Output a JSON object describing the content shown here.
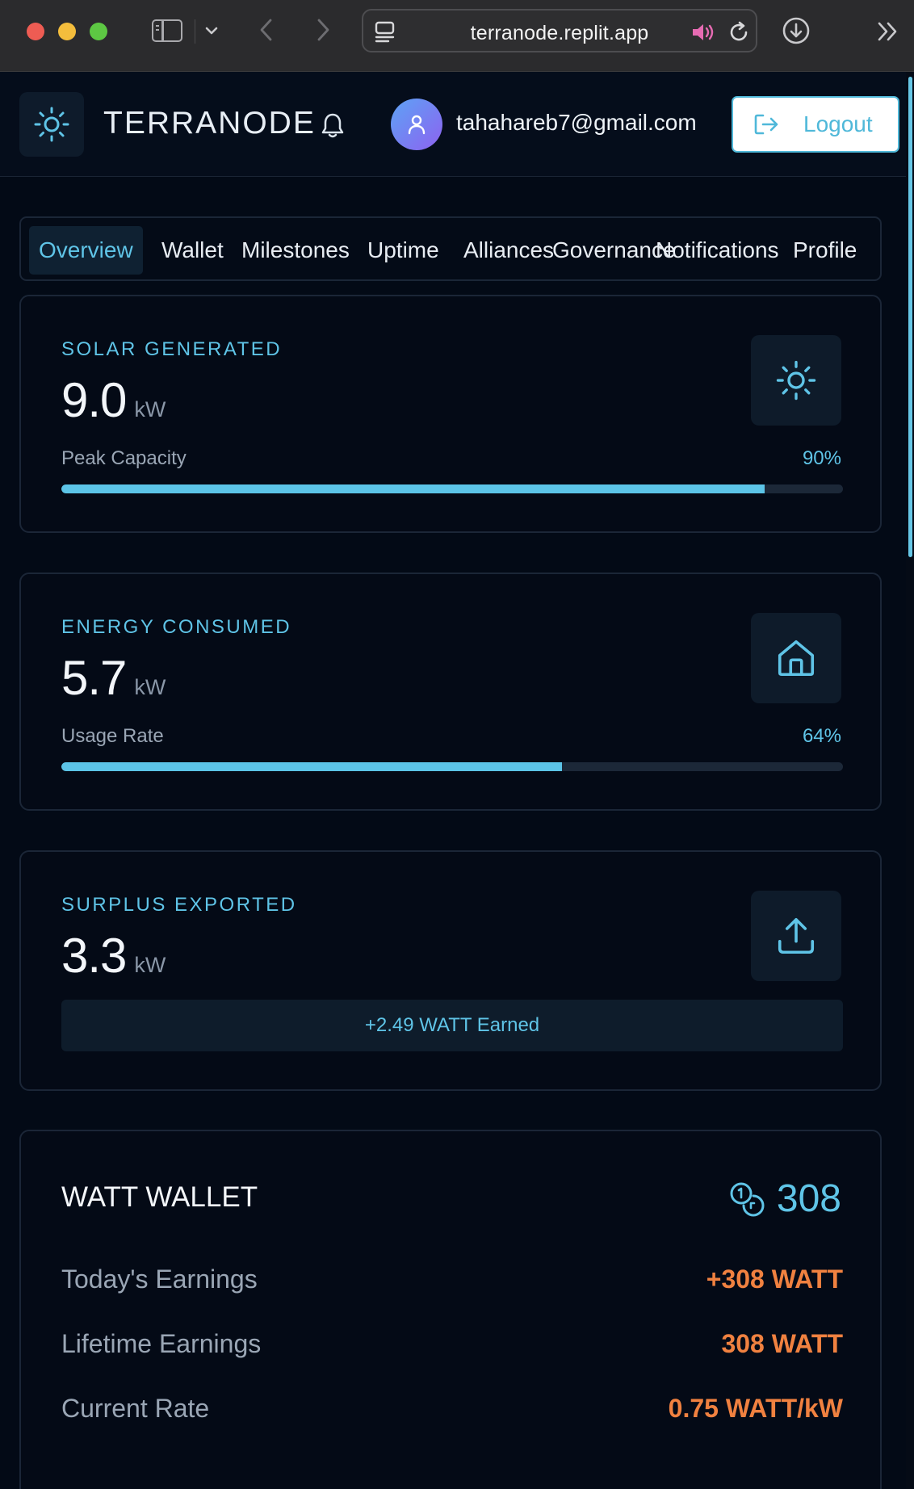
{
  "browser": {
    "url": "terranode.replit.app"
  },
  "header": {
    "brand": "TERRANODE",
    "user_email": "tahahareb7@gmail.com",
    "logout_label": "Logout"
  },
  "tabs": [
    {
      "label": "Overview",
      "active": true
    },
    {
      "label": "Wallet"
    },
    {
      "label": "Milestones"
    },
    {
      "label": "Uptime"
    },
    {
      "label": "Alliances"
    },
    {
      "label": "Governance"
    },
    {
      "label": "Notifications"
    },
    {
      "label": "Profile"
    }
  ],
  "solar": {
    "label": "SOLAR GENERATED",
    "value": "9.0",
    "unit": "kW",
    "meter_label": "Peak Capacity",
    "meter_pct_text": "90%",
    "meter_fraction": 0.9
  },
  "consumed": {
    "label": "ENERGY CONSUMED",
    "value": "5.7",
    "unit": "kW",
    "meter_label": "Usage Rate",
    "meter_pct_text": "64%",
    "meter_fraction": 0.64
  },
  "surplus": {
    "label": "SURPLUS EXPORTED",
    "value": "3.3",
    "unit": "kW",
    "earned": "+2.49 WATT Earned"
  },
  "wallet": {
    "title": "WATT WALLET",
    "balance": "308",
    "rows": [
      {
        "label": "Today's Earnings",
        "value": "+308 WATT"
      },
      {
        "label": "Lifetime Earnings",
        "value": "308 WATT"
      },
      {
        "label": "Current Rate",
        "value": "0.75 WATT/kW"
      }
    ]
  },
  "colors": {
    "accent": "#5fc4e7",
    "earnings": "#f08140",
    "background": "#030a16"
  },
  "icons": {
    "logo": "sun-icon",
    "solar": "sun-icon",
    "consumed": "home-icon",
    "surplus": "upload-icon",
    "wallet": "coins-icon"
  }
}
